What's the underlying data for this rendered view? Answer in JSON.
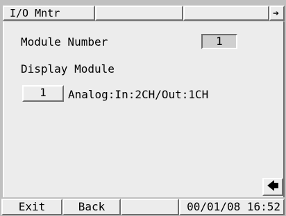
{
  "tabs": [
    {
      "label": "I/O Mntr"
    },
    {
      "label": ""
    },
    {
      "label": ""
    }
  ],
  "tab_arrow_icon": "right-arrow",
  "module_number": {
    "label": "Module Number",
    "value": "1"
  },
  "display_module": {
    "label": "Display Module",
    "button_value": "1",
    "description": "Analog:In:2CH/Out:1CH"
  },
  "back_arrow_icon": "left-arrow",
  "footer": {
    "exit_label": "Exit",
    "back_label": "Back",
    "empty_label": "",
    "datetime": "00/01/08 16:52"
  }
}
